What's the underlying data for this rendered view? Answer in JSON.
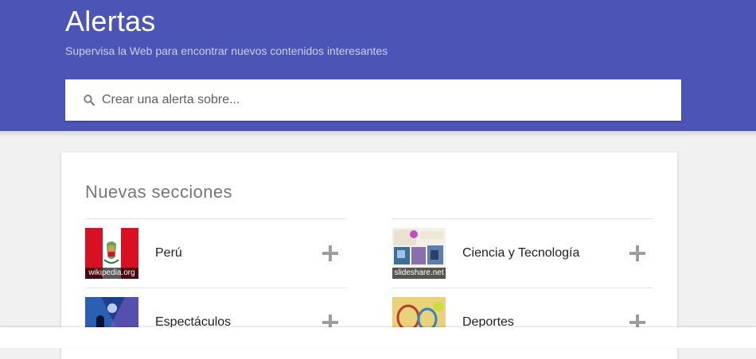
{
  "header": {
    "title": "Alertas",
    "subtitle": "Supervisa la Web para encontrar nuevos contenidos interesantes"
  },
  "search": {
    "placeholder": "Crear una alerta sobre..."
  },
  "section": {
    "title": "Nuevas secciones",
    "items": [
      {
        "label": "Perú",
        "source": "wikipedia.org",
        "thumb_icon": "peru-flag-icon"
      },
      {
        "label": "Ciencia y Tecnología",
        "source": "slideshare.net",
        "thumb_icon": "science-collage-icon"
      },
      {
        "label": "Espectáculos",
        "source": "",
        "thumb_icon": "concert-icon"
      },
      {
        "label": "Deportes",
        "source": "",
        "thumb_icon": "tennis-icon"
      }
    ],
    "add_icon": "plus-icon"
  },
  "colors": {
    "header_bg": "#4a55b6",
    "page_bg": "#f1f1f1",
    "plus": "#9e9e9e"
  }
}
